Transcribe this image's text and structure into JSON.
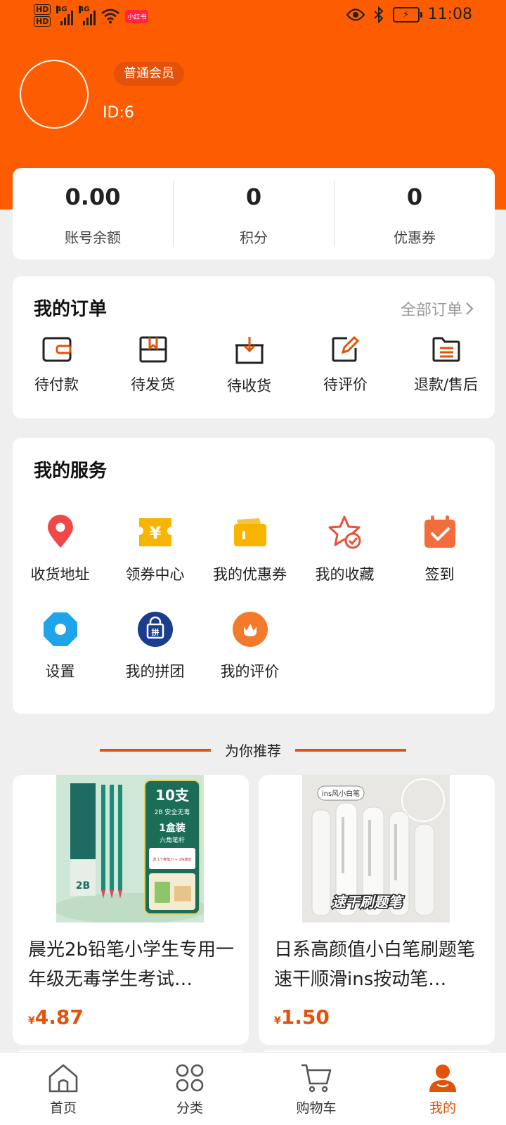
{
  "status_bar": {
    "hd1": "HD",
    "hd2": "HD",
    "signal1": "4G",
    "signal2": "4G",
    "app_badge": "小红书",
    "time": "11:08"
  },
  "profile": {
    "member_level": "普通会员",
    "user_id": "ID:6"
  },
  "stats": [
    {
      "value": "0.00",
      "label": "账号余额"
    },
    {
      "value": "0",
      "label": "积分"
    },
    {
      "value": "0",
      "label": "优惠券"
    }
  ],
  "orders": {
    "title": "我的订单",
    "all_label": "全部订单",
    "items": [
      {
        "label": "待付款",
        "icon": "wallet-icon"
      },
      {
        "label": "待发货",
        "icon": "package-icon"
      },
      {
        "label": "待收货",
        "icon": "receive-box-icon"
      },
      {
        "label": "待评价",
        "icon": "edit-icon"
      },
      {
        "label": "退款/售后",
        "icon": "refund-list-icon"
      }
    ]
  },
  "services": {
    "title": "我的服务",
    "items": [
      {
        "label": "收货地址",
        "icon": "location-pin-icon",
        "color": "#f04848"
      },
      {
        "label": "领券中心",
        "icon": "coupon-center-icon",
        "color": "#f7b500"
      },
      {
        "label": "我的优惠券",
        "icon": "coupon-icon",
        "color": "#f7b500"
      },
      {
        "label": "我的收藏",
        "icon": "star-check-icon",
        "color": "#e8513a"
      },
      {
        "label": "签到",
        "icon": "calendar-check-icon",
        "color": "#f26d3d"
      },
      {
        "label": "设置",
        "icon": "settings-icon",
        "color": "#1ea5e9"
      },
      {
        "label": "我的拼团",
        "icon": "group-buy-icon",
        "color": "#1a3d8f"
      },
      {
        "label": "我的评价",
        "icon": "review-flower-icon",
        "color": "#f27a2a"
      }
    ]
  },
  "recommend": {
    "title": "为你推荐",
    "accent": "#e3520a"
  },
  "products": [
    {
      "name": "晨光2b铅笔小学生专用一年级无毒学生考试…",
      "currency": "¥",
      "price": "4.87",
      "image_text": {
        "count": "10支",
        "spec": "2B 安全无毒",
        "pack": "1盒装",
        "shape": "六角笔杆",
        "gift": "送 1个卷笔刀 + 2块橡皮",
        "grade": "2B"
      }
    },
    {
      "name": "日系高颜值小白笔刷题笔速干顺滑ins按动笔…",
      "currency": "¥",
      "price": "1.50",
      "image_text": {
        "tag": "ins风小白笔",
        "caption": "速干刷题笔"
      }
    }
  ],
  "tabbar": {
    "active_color": "#e3520a",
    "tabs": [
      {
        "label": "首页",
        "icon": "home-icon"
      },
      {
        "label": "分类",
        "icon": "category-icon"
      },
      {
        "label": "购物车",
        "icon": "cart-icon"
      },
      {
        "label": "我的",
        "icon": "profile-icon"
      }
    ]
  }
}
